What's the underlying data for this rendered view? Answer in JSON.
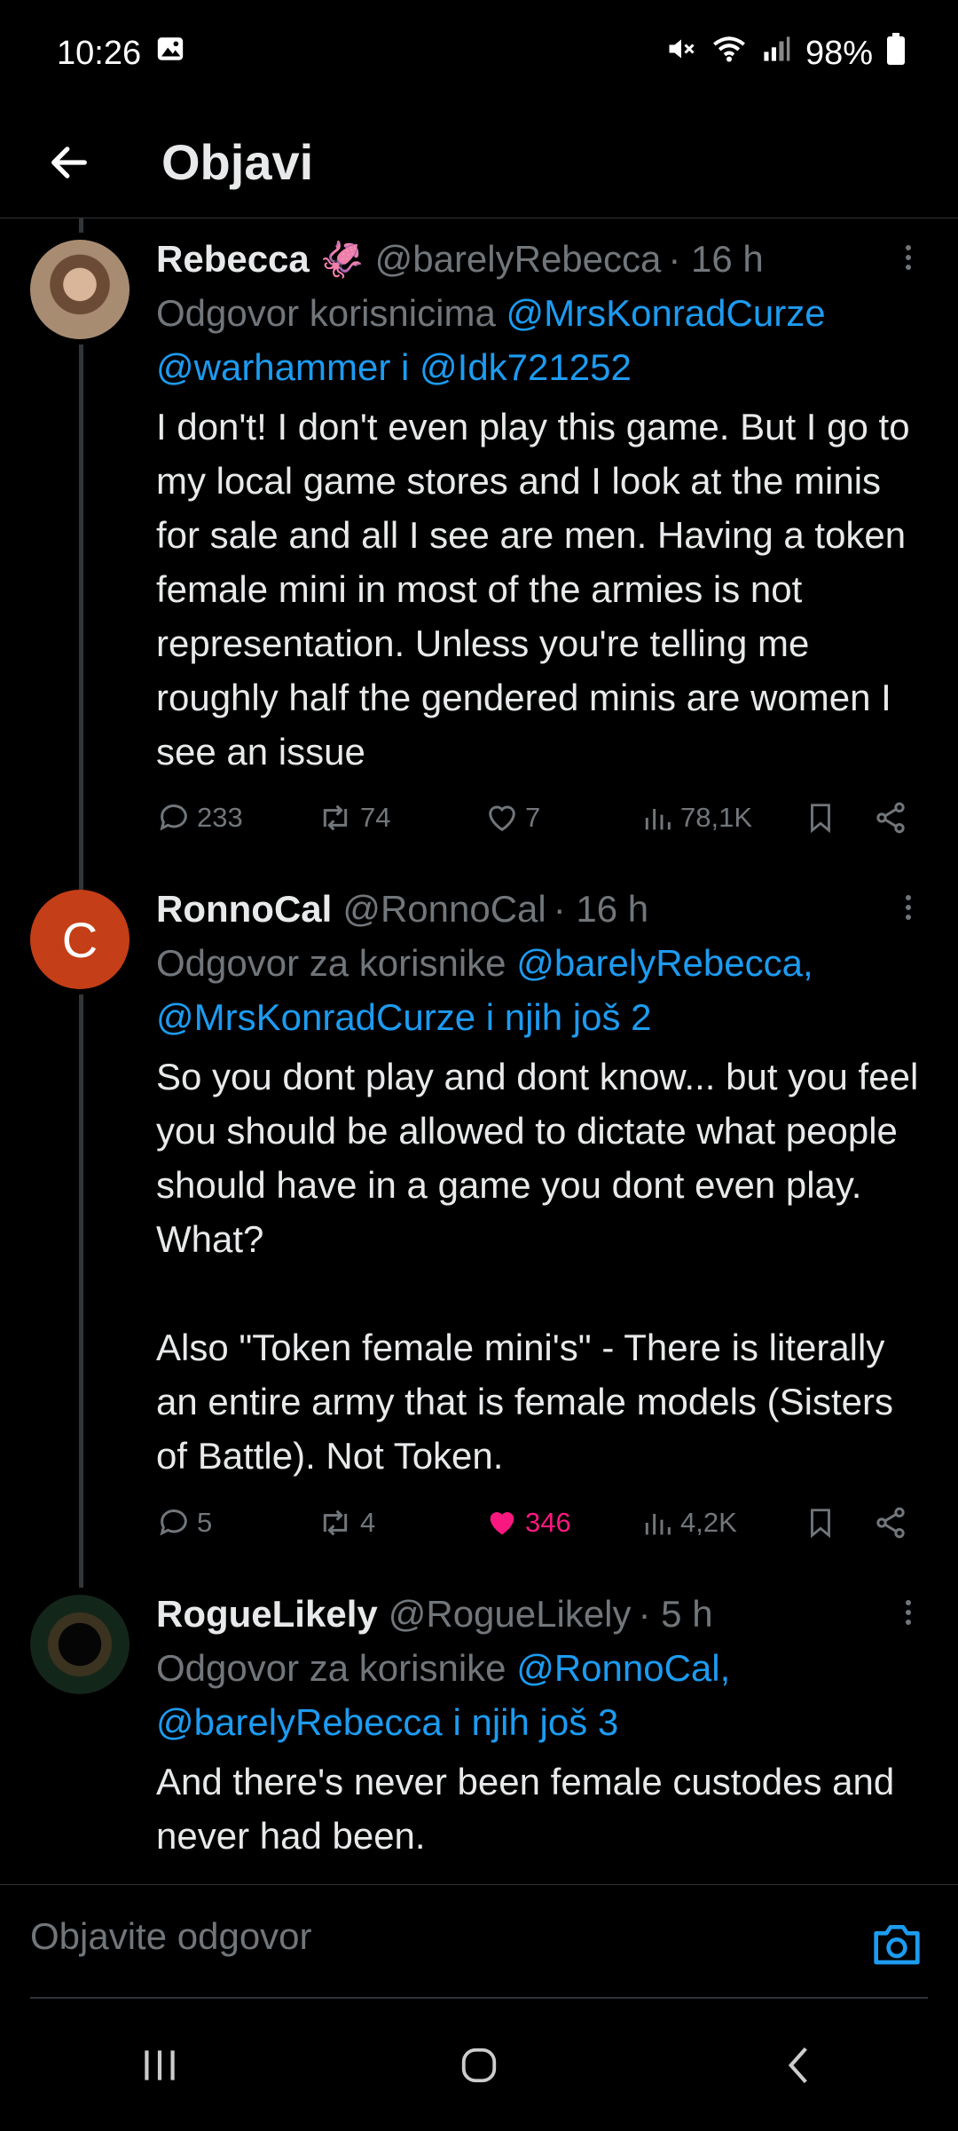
{
  "status": {
    "time": "10:26",
    "battery": "98%"
  },
  "header": {
    "title": "Objavi"
  },
  "tweets": [
    {
      "name": "Rebecca",
      "emoji": "🦑",
      "handle": "@barelyRebecca",
      "time": "· 16 h",
      "reply_prefix": "Odgovor korisnicima",
      "reply_mentions": "@MrsKonradCurze @warhammer i @Idk721252",
      "text": "I don't! I don't even play this game. But I go to my local game stores and I look at the minis for sale and all I see are men. Having a token female mini in most of the armies is not representation. Unless you're telling me roughly half the gendered minis are women I see an issue",
      "replies": "233",
      "reposts": "74",
      "likes": "7",
      "views": "78,1K",
      "liked": false
    },
    {
      "name": "RonnoCal",
      "avatar_letter": "C",
      "handle": "@RonnoCal",
      "time": "· 16 h",
      "reply_prefix": "Odgovor za korisnike",
      "reply_mentions": "@barelyRebecca, @MrsKonradCurze i njih još 2",
      "text": "So you dont play and dont know... but you feel you should be allowed to dictate what people should have in a game you dont even play. What?\n\nAlso \"Token female mini's\" - There is literally an entire army that is female models (Sisters of Battle). Not Token.",
      "replies": "5",
      "reposts": "4",
      "likes": "346",
      "views": "4,2K",
      "liked": true
    },
    {
      "name": "RogueLikely",
      "handle": "@RogueLikely",
      "time": "· 5 h",
      "reply_prefix": "Odgovor za korisnike",
      "reply_mentions": "@RonnoCal, @barelyRebecca i njih još 3",
      "text": "And there's never been female custodes and never had been."
    }
  ],
  "compose": {
    "placeholder": "Objavite odgovor"
  },
  "colors": {
    "accent": "#1d9bf0",
    "like": "#f91880",
    "muted": "#71767b"
  },
  "icons": [
    "back-arrow-icon",
    "camera-icon",
    "reply-icon",
    "repost-icon",
    "heart-icon",
    "views-icon",
    "bookmark-icon",
    "share-icon",
    "more-icon"
  ]
}
